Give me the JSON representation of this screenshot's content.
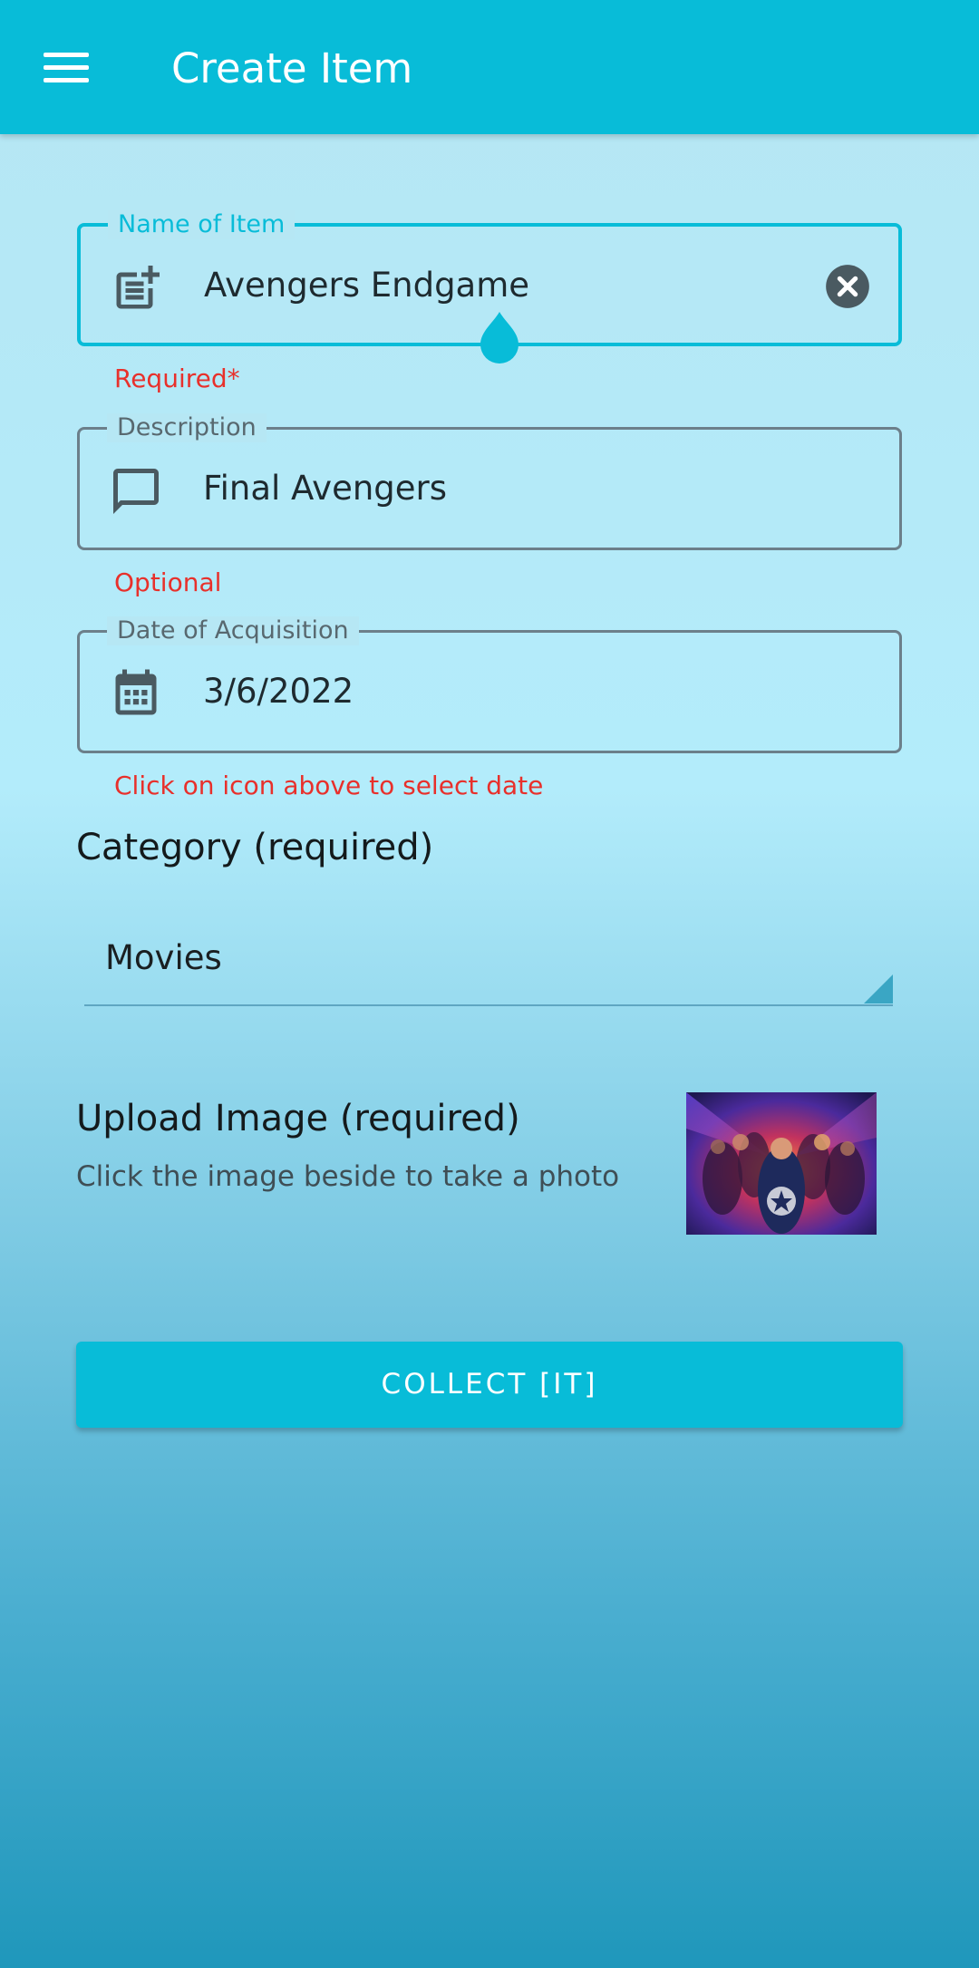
{
  "appbar": {
    "title": "Create Item",
    "menu_icon": "hamburger-menu-icon"
  },
  "form": {
    "name": {
      "label": "Name of Item",
      "value": "Avengers Endgame",
      "helper": "Required*",
      "icon": "post-add-icon",
      "clear_icon": "clear-circle-icon"
    },
    "description": {
      "label": "Description",
      "value": "Final Avengers",
      "helper": "Optional",
      "icon": "chat-bubble-icon"
    },
    "date": {
      "label": "Date of Acquisition",
      "value": "3/6/2022",
      "helper": "Click on icon above to select date",
      "icon": "calendar-icon"
    },
    "category": {
      "heading": "Category (required)",
      "selected": "Movies"
    },
    "upload": {
      "heading": "Upload Image (required)",
      "subtitle": "Click the image beside to take a photo"
    },
    "submit_label": "COLLECT [IT]"
  },
  "colors": {
    "accent": "#08bcd8",
    "error": "#e8302b",
    "border": "#6c7f8a",
    "icon": "#4a5a61"
  }
}
